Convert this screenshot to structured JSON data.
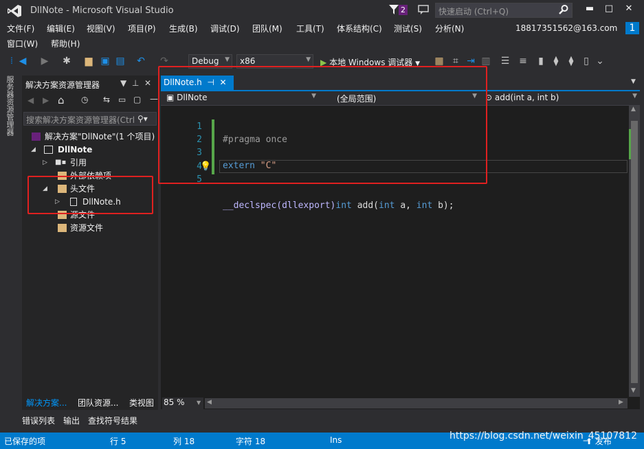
{
  "window": {
    "title": "DllNote - Microsoft Visual Studio",
    "notifications_badge": "2",
    "quick_launch_placeholder": "快速启动 (Ctrl+Q)",
    "account": "18817351562@163.com",
    "notify_count": "1"
  },
  "menu": {
    "row1": [
      "文件(F)",
      "编辑(E)",
      "视图(V)",
      "项目(P)",
      "生成(B)",
      "调试(D)",
      "团队(M)",
      "工具(T)",
      "体系结构(C)",
      "测试(S)",
      "分析(N)"
    ],
    "row2": [
      "窗口(W)",
      "帮助(H)"
    ]
  },
  "toolbar": {
    "config": "Debug",
    "platform": "x86",
    "run_label": "本地 Windows 调试器"
  },
  "left_strip": {
    "label": "服务器资源管理器"
  },
  "solution_explorer": {
    "title": "解决方案资源管理器",
    "search_placeholder": "搜索解决方案资源管理器(Ctrl",
    "tree": [
      {
        "label": "解决方案\"DllNote\"(1 个项目)"
      },
      {
        "label": "DllNote"
      },
      {
        "label": "引用"
      },
      {
        "label": "外部依赖项"
      },
      {
        "label": "头文件"
      },
      {
        "label": "DllNote.h"
      },
      {
        "label": "源文件"
      },
      {
        "label": "资源文件"
      }
    ],
    "tabs": [
      "解决方案...",
      "团队资源...",
      "类视图"
    ]
  },
  "editor": {
    "tab_title": "DllNote.h",
    "nav": {
      "file": "DllNote",
      "scope": "(全局范围)",
      "member": "add(int a, int b)"
    },
    "line_numbers": [
      "1",
      "2",
      "3",
      "4",
      "5"
    ],
    "code": {
      "l1": "#pragma once",
      "l3_kw": "extern",
      "l3_str": "\"C\"",
      "l5_mac": "__declspec",
      "l5_paren": "(dllexport)",
      "l5_int1": "int",
      "l5_fn": "add",
      "l5_open": "(",
      "l5_int2": "int",
      "l5_a": "a,",
      "l5_int3": "int",
      "l5_b": "b);"
    },
    "zoom": "85 %"
  },
  "bottom_tabs": [
    "错误列表",
    "输出",
    "查找符号结果"
  ],
  "status": {
    "saved": "已保存的项",
    "line": "行 5",
    "col": "列 18",
    "char": "字符 18",
    "mode": "Ins",
    "publish": "发布"
  },
  "watermark": "https://blog.csdn.net/weixin_45107812",
  "colors": {
    "accent": "#007acc",
    "annotation": "#e02020"
  }
}
